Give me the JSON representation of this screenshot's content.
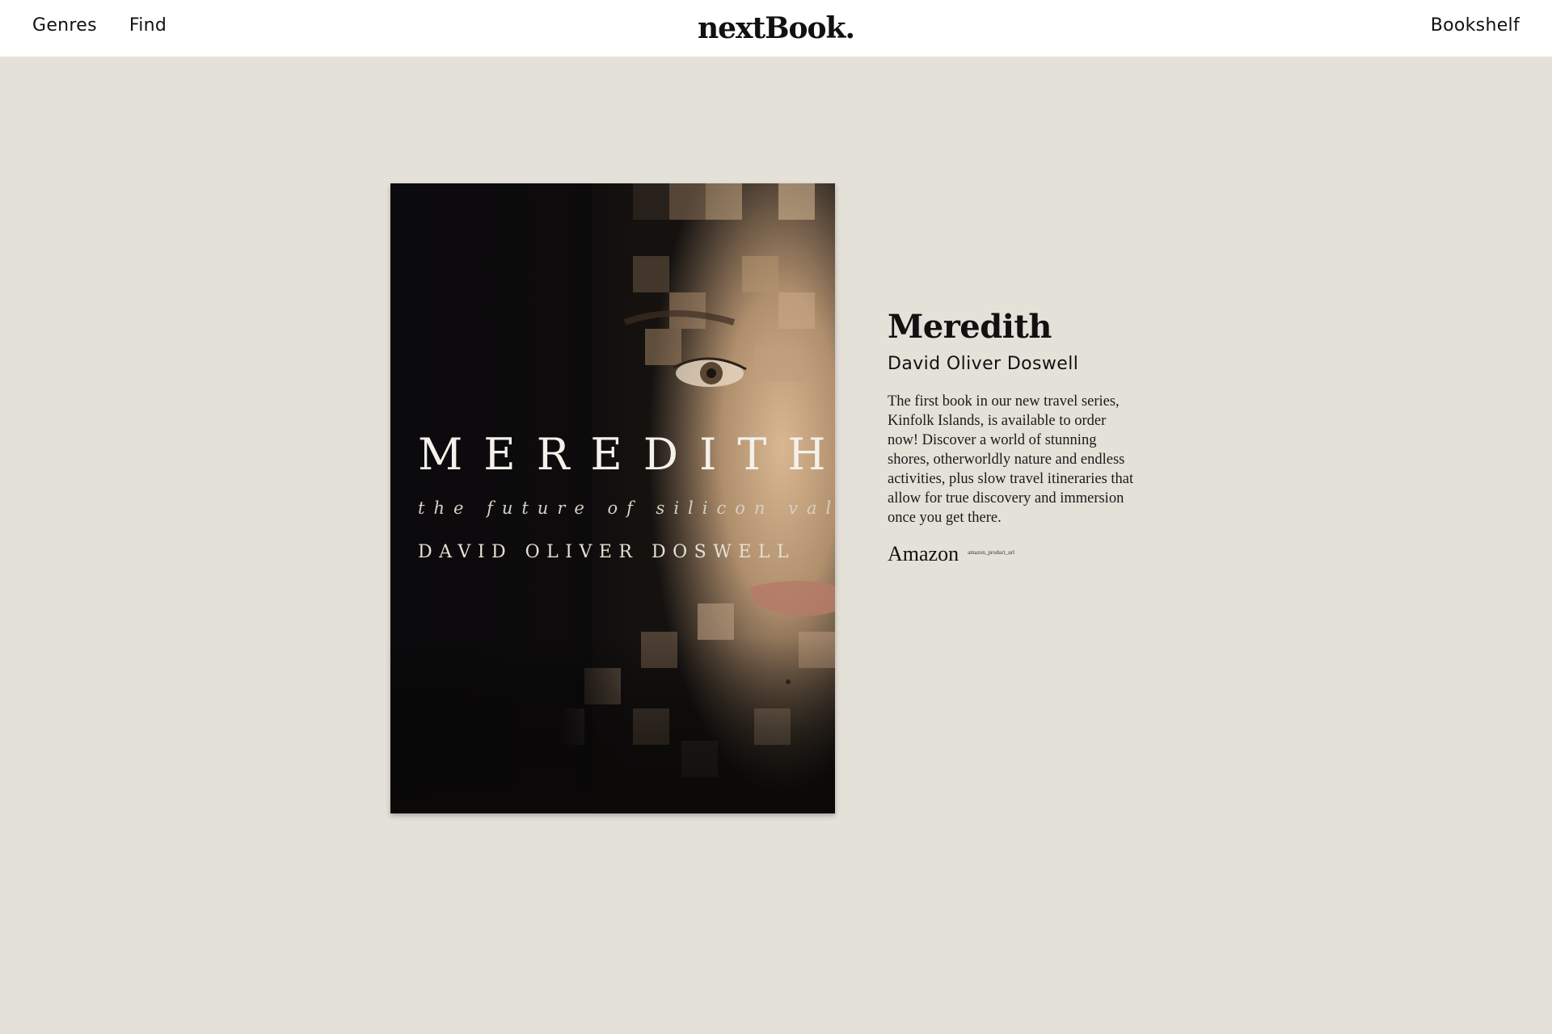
{
  "header": {
    "nav_left": [
      {
        "label": "Genres"
      },
      {
        "label": "Find"
      }
    ],
    "logo": "nextBook.",
    "nav_right": {
      "label": "Bookshelf"
    }
  },
  "book": {
    "cover": {
      "title": "MEREDITH",
      "subtitle": "the future of silicon valley",
      "author": "DAVID OLIVER DOSWELL"
    },
    "title": "Meredith",
    "author": "David Oliver Doswell",
    "description": "The first book in our new travel series, Kinfolk Islands, is available to order now! Discover a world of stunning shores, otherworldly nature and endless activities, plus slow travel itineraries that allow for true discovery and immersion once you get there.",
    "buy": {
      "label": "Amazon",
      "url_text": "amazon_product_url"
    }
  },
  "colors": {
    "background": "#e4e1d9",
    "header": "#ffffff",
    "text": "#111111",
    "cover_dark": "#0b0a0c",
    "skin": "#c9a584"
  }
}
